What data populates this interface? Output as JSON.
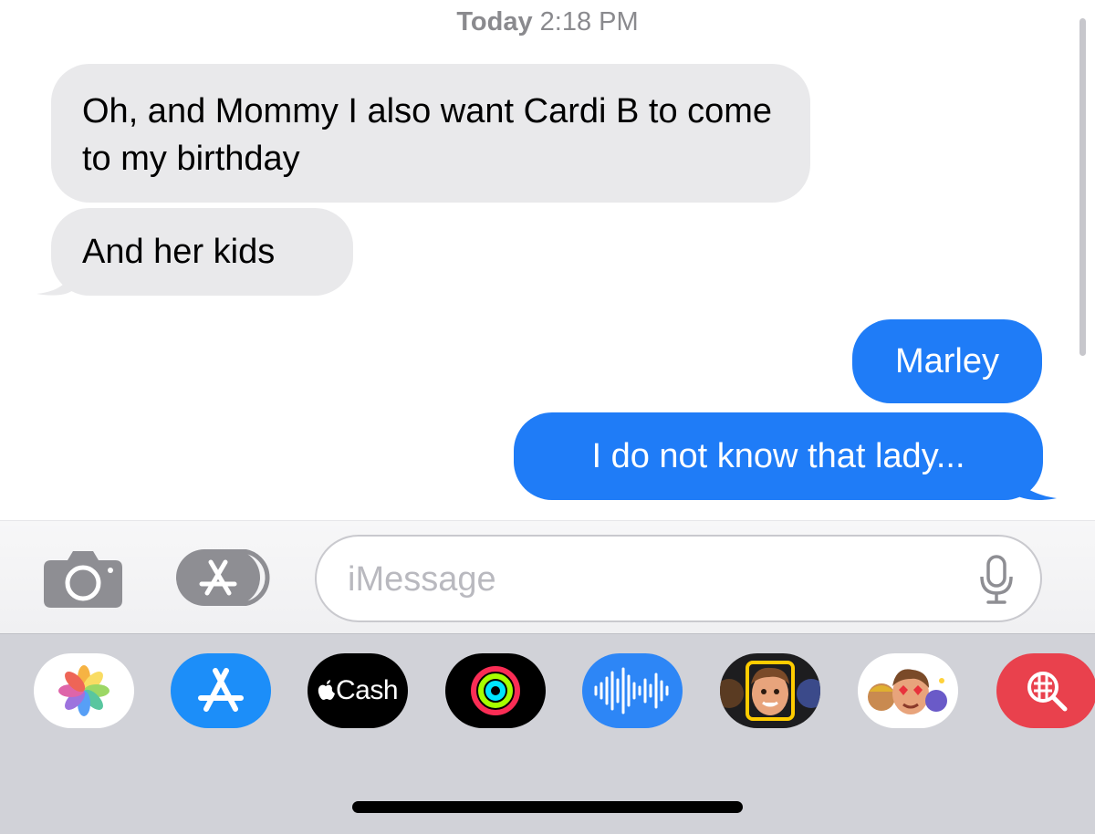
{
  "thread": {
    "timestamp_day": "Today",
    "timestamp_time": "2:18 PM",
    "messages": [
      {
        "direction": "incoming",
        "text": "Oh, and Mommy I also want Cardi B to come to my birthday"
      },
      {
        "direction": "incoming",
        "text": "And her kids"
      },
      {
        "direction": "outgoing",
        "text": "Marley"
      },
      {
        "direction": "outgoing",
        "text": "I do not know that lady..."
      }
    ]
  },
  "composer": {
    "placeholder": "iMessage",
    "camera_icon": "camera-icon",
    "apps_icon": "app-store-icon",
    "mic_icon": "microphone-icon"
  },
  "app_drawer": {
    "cash_label": "Cash",
    "apps": [
      "photos-icon",
      "app-store-icon",
      "apple-cash-icon",
      "activity-icon",
      "audio-message-icon",
      "memoji-icon",
      "memoji-stickers-icon",
      "image-search-icon"
    ]
  },
  "colors": {
    "incoming_bubble": "#e9e9eb",
    "outgoing_bubble": "#1f7cf7",
    "drawer_background": "#d1d2d8"
  }
}
